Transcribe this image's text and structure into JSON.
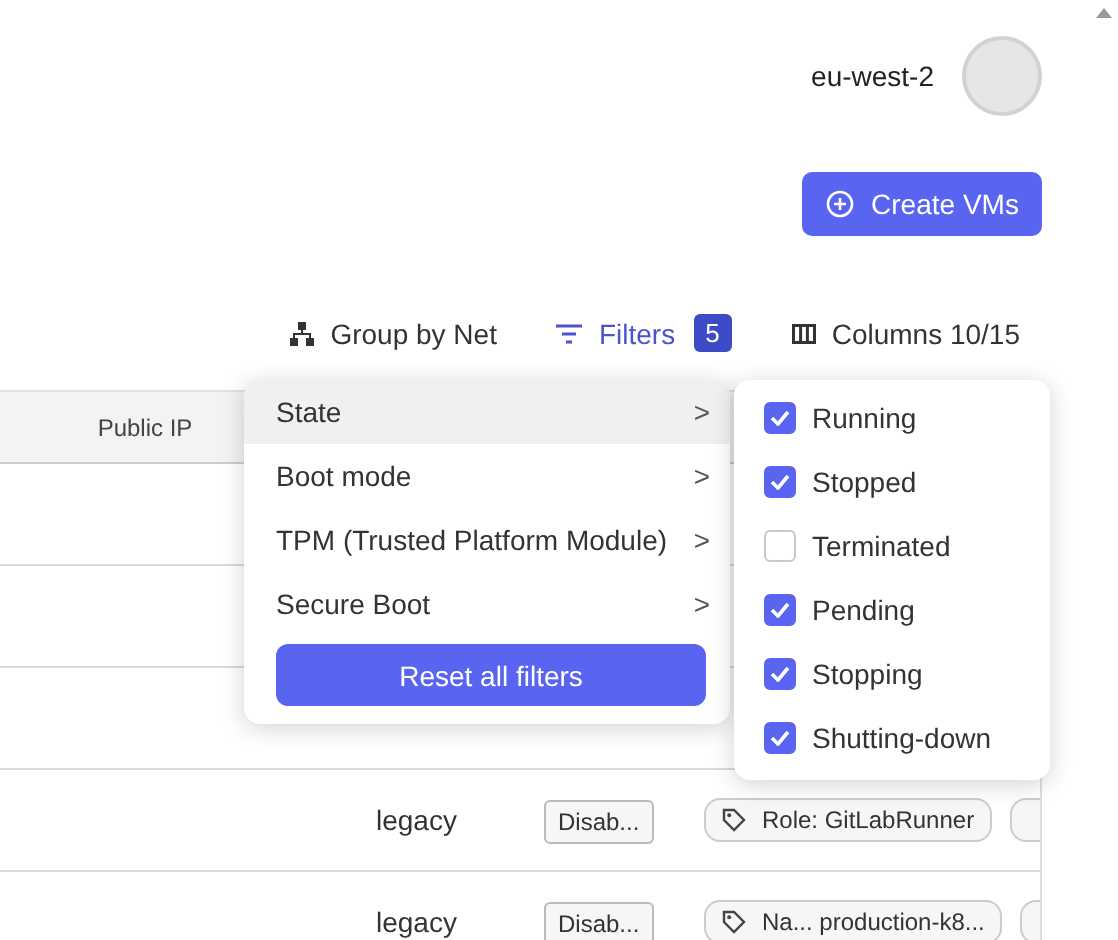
{
  "header": {
    "region": "eu-west-2"
  },
  "create_button": {
    "label": "Create VMs"
  },
  "toolbar": {
    "group_by": "Group by Net",
    "filters": {
      "label": "Filters",
      "count": "5"
    },
    "columns": "Columns 10/15"
  },
  "table": {
    "columns": [
      "Public IP"
    ],
    "rows": [
      {
        "boot_mode": "legacy",
        "secure_boot": "Disab...",
        "tags": [
          "Role: GitLabRunner"
        ]
      },
      {
        "boot_mode": "legacy",
        "secure_boot": "Disab...",
        "tags": [
          "Na... production-k8..."
        ]
      }
    ]
  },
  "filter_menu": {
    "items": [
      {
        "label": "State",
        "selected": true
      },
      {
        "label": "Boot mode",
        "selected": false
      },
      {
        "label": "TPM (Trusted Platform Module)",
        "selected": false
      },
      {
        "label": "Secure Boot",
        "selected": false
      }
    ],
    "chevron": ">",
    "reset_button": "Reset all filters"
  },
  "state_submenu": {
    "options": [
      {
        "label": "Running",
        "checked": true
      },
      {
        "label": "Stopped",
        "checked": true
      },
      {
        "label": "Terminated",
        "checked": false
      },
      {
        "label": "Pending",
        "checked": true
      },
      {
        "label": "Stopping",
        "checked": true
      },
      {
        "label": "Shutting-down",
        "checked": true
      }
    ]
  }
}
